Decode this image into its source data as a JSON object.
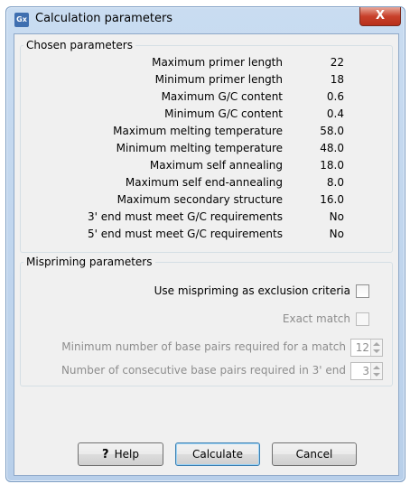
{
  "window": {
    "app_icon_text": "Gx",
    "title": "Calculation parameters",
    "close_glyph": "X"
  },
  "chosen": {
    "legend": "Chosen parameters",
    "rows": [
      {
        "label": "Maximum primer length",
        "value": "22"
      },
      {
        "label": "Minimum primer length",
        "value": "18"
      },
      {
        "label": "Maximum G/C content",
        "value": "0.6"
      },
      {
        "label": "Minimum G/C content",
        "value": "0.4"
      },
      {
        "label": "Maximum melting temperature",
        "value": "58.0"
      },
      {
        "label": "Minimum melting temperature",
        "value": "48.0"
      },
      {
        "label": "Maximum self annealing",
        "value": "18.0"
      },
      {
        "label": "Maximum self end-annealing",
        "value": "8.0"
      },
      {
        "label": "Maximum secondary structure",
        "value": "16.0"
      },
      {
        "label": "3' end must meet G/C requirements",
        "value": "No"
      },
      {
        "label": "5' end must meet G/C requirements",
        "value": "No"
      }
    ]
  },
  "mispriming": {
    "legend": "Mispriming parameters",
    "use_exclusion_label": "Use mispriming as exclusion criteria",
    "use_exclusion_checked": false,
    "exact_match_label": "Exact match",
    "exact_match_checked": false,
    "min_pairs_label": "Minimum number of base pairs required for a match",
    "min_pairs_value": "12",
    "consecutive_label": "Number of consecutive base pairs required in 3' end",
    "consecutive_value": "3"
  },
  "buttons": {
    "help_icon": "?",
    "help": "Help",
    "calculate": "Calculate",
    "cancel": "Cancel"
  },
  "colors": {
    "title_bar": "#c9dcf1",
    "close_button": "#c8412b",
    "dialog_bg": "#f0f0f0",
    "disabled_text": "#8d8d8d",
    "default_button_border": "#3c7fb1"
  }
}
